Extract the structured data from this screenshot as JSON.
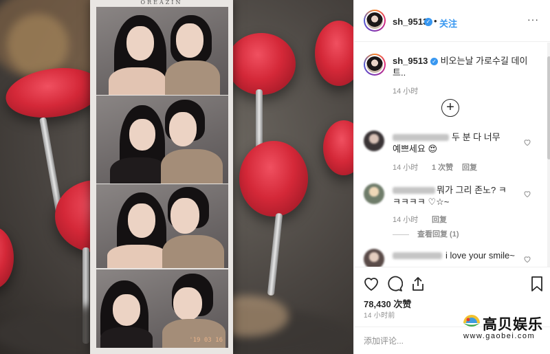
{
  "post": {
    "username": "sh_9513",
    "verified": true,
    "separator": "•",
    "follow_label": "关注",
    "more_label": "···",
    "caption_username": "sh_9513",
    "caption_text": "비오는날 가로수길 데이트..",
    "caption_time": "14 小时",
    "load_more_label": "+"
  },
  "photo": {
    "strip_brand": "OREAZIN",
    "timestamp": "'19 03 16"
  },
  "comments": [
    {
      "text": "두 분 다 너무 예쁘세요 😍",
      "time": "14 小时",
      "likes": "1 次赞",
      "reply": "回复"
    },
    {
      "text": "뭐가 그리 존노? ㅋㅋㅋㅋㅋ ♡☆~",
      "time": "14 小时",
      "likes": "",
      "reply": "回复",
      "view_replies": "查看回复 (1)"
    },
    {
      "text": "i love your smile~",
      "time": "",
      "likes": "",
      "reply": ""
    }
  ],
  "actions": {
    "like_icon": "heart-icon",
    "comment_icon": "comment-icon",
    "share_icon": "share-icon",
    "save_icon": "bookmark-icon"
  },
  "likes_count": "78,430 次赞",
  "post_time": "14 小时前",
  "comment_placeholder": "添加评论...",
  "watermark": {
    "title": "高贝娱乐",
    "url": "www.gaobei.com"
  },
  "colors": {
    "accent": "#3897f0",
    "text": "#262626",
    "muted": "#8e8e8e",
    "border": "#efefef"
  }
}
